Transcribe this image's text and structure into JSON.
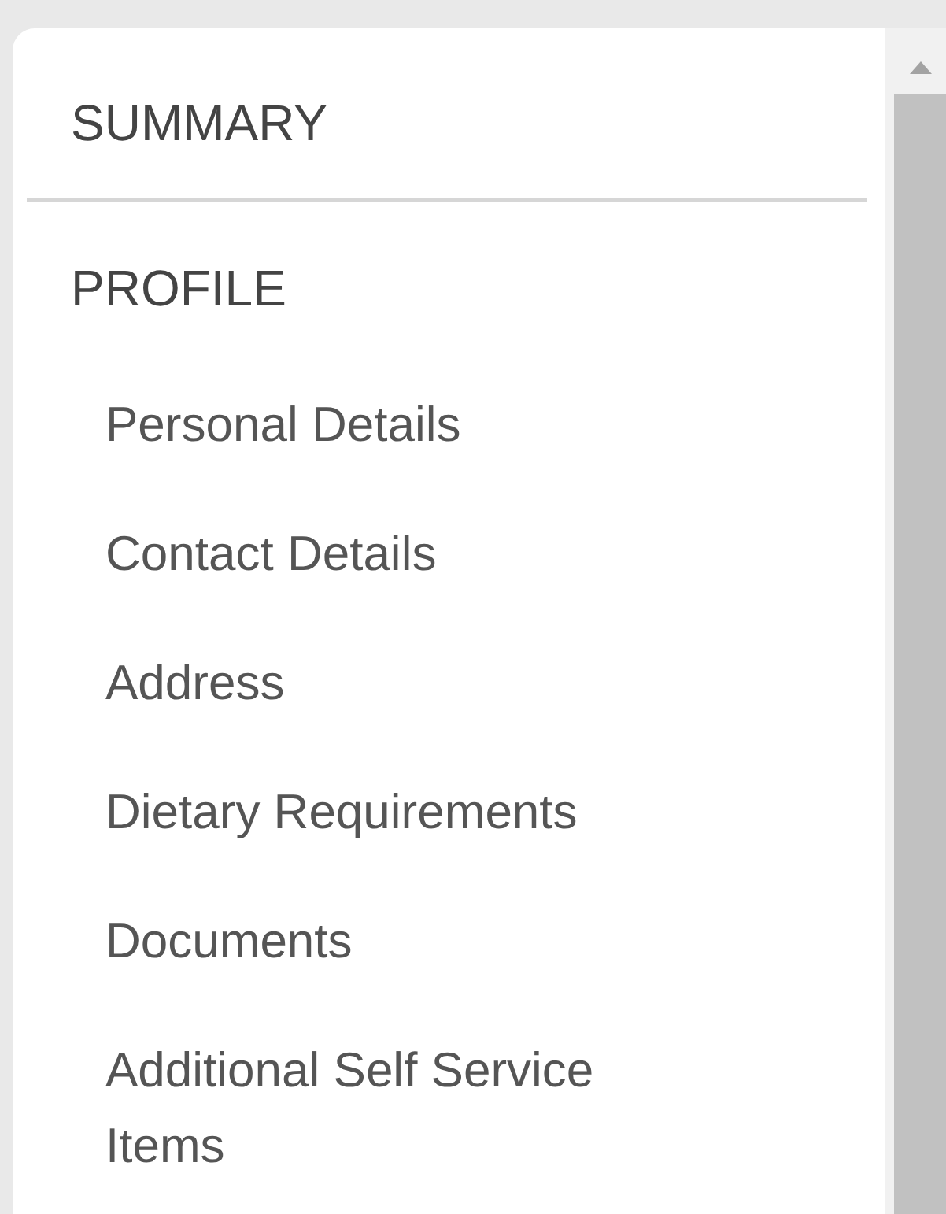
{
  "nav": {
    "sections": [
      {
        "title": "SUMMARY"
      },
      {
        "title": "PROFILE",
        "items": [
          {
            "label": "Personal Details"
          },
          {
            "label": "Contact Details"
          },
          {
            "label": "Address"
          },
          {
            "label": "Dietary Requirements"
          },
          {
            "label": "Documents"
          },
          {
            "label": "Additional Self Service Items"
          }
        ]
      }
    ]
  }
}
